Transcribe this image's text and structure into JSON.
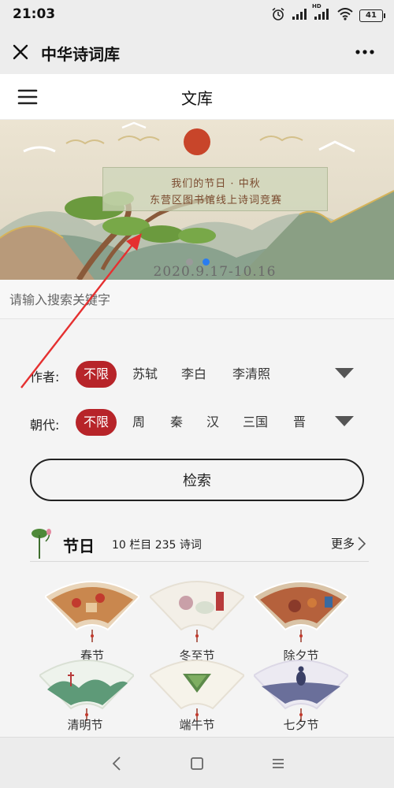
{
  "status": {
    "time": "21:03",
    "battery": "41",
    "network": "HD"
  },
  "titlebar": {
    "title": "中华诗词库"
  },
  "app": {
    "title": "文库"
  },
  "banner": {
    "line1": "我们的节日 · 中秋",
    "line2": "东营区图书馆线上诗词竞赛",
    "date": "2020.9.17-10.16"
  },
  "search": {
    "placeholder": "请输入搜索关键字"
  },
  "filters": {
    "author": {
      "label": "作者:",
      "options": [
        "不限",
        "苏轼",
        "李白",
        "李清照"
      ],
      "selected": "不限"
    },
    "dynasty": {
      "label": "朝代:",
      "options": [
        "不限",
        "周",
        "秦",
        "汉",
        "三国",
        "晋"
      ],
      "selected": "不限"
    },
    "search_button": "检索"
  },
  "section": {
    "title": "节日",
    "count": "10 栏目 235 诗词",
    "more": "更多",
    "items": [
      {
        "label": "春节"
      },
      {
        "label": "冬至节"
      },
      {
        "label": "除夕节"
      },
      {
        "label": "清明节"
      },
      {
        "label": "端午节"
      },
      {
        "label": "七夕节"
      }
    ]
  },
  "colors": {
    "accent": "#b72429",
    "link_blue": "#2a7df0",
    "annotation_arrow": "#e53030"
  }
}
